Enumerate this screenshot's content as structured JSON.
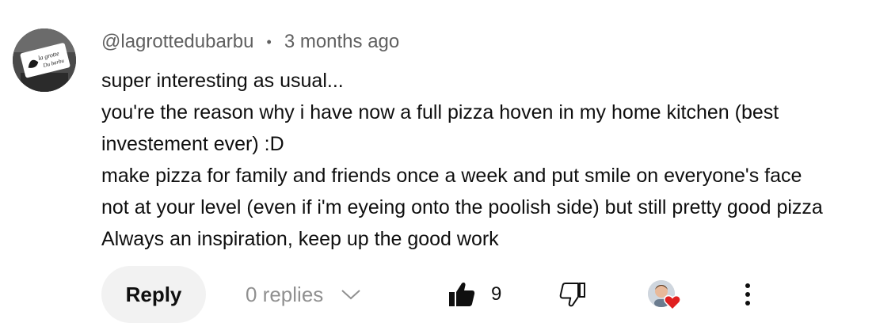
{
  "comment": {
    "author": "@lagrottedubarbu",
    "separator": "•",
    "timestamp": "3 months ago",
    "lines": [
      "super interesting as usual...",
      "you're the reason why i have now a full pizza hoven in my home kitchen (best",
      "investement ever) :D",
      "make pizza for family and friends once a week and put smile on everyone's face",
      "not at your level (even if i'm eyeing onto the poolish side) but still pretty good pizza",
      "Always an inspiration, keep up the good work"
    ]
  },
  "avatar": {
    "logo_text_line1": "la grotte",
    "logo_text_line2": "Du barbu"
  },
  "actions": {
    "reply_label": "Reply",
    "replies_label": "0 replies",
    "like_count": "9",
    "like_icon": "thumbs-up-icon",
    "dislike_icon": "thumbs-down-icon",
    "heart_icon": "creator-heart-icon",
    "more_icon": "more-vert-icon"
  },
  "colors": {
    "secondary_text": "#606060",
    "reply_bg": "#f2f2f2",
    "heart_red": "#e02020"
  }
}
